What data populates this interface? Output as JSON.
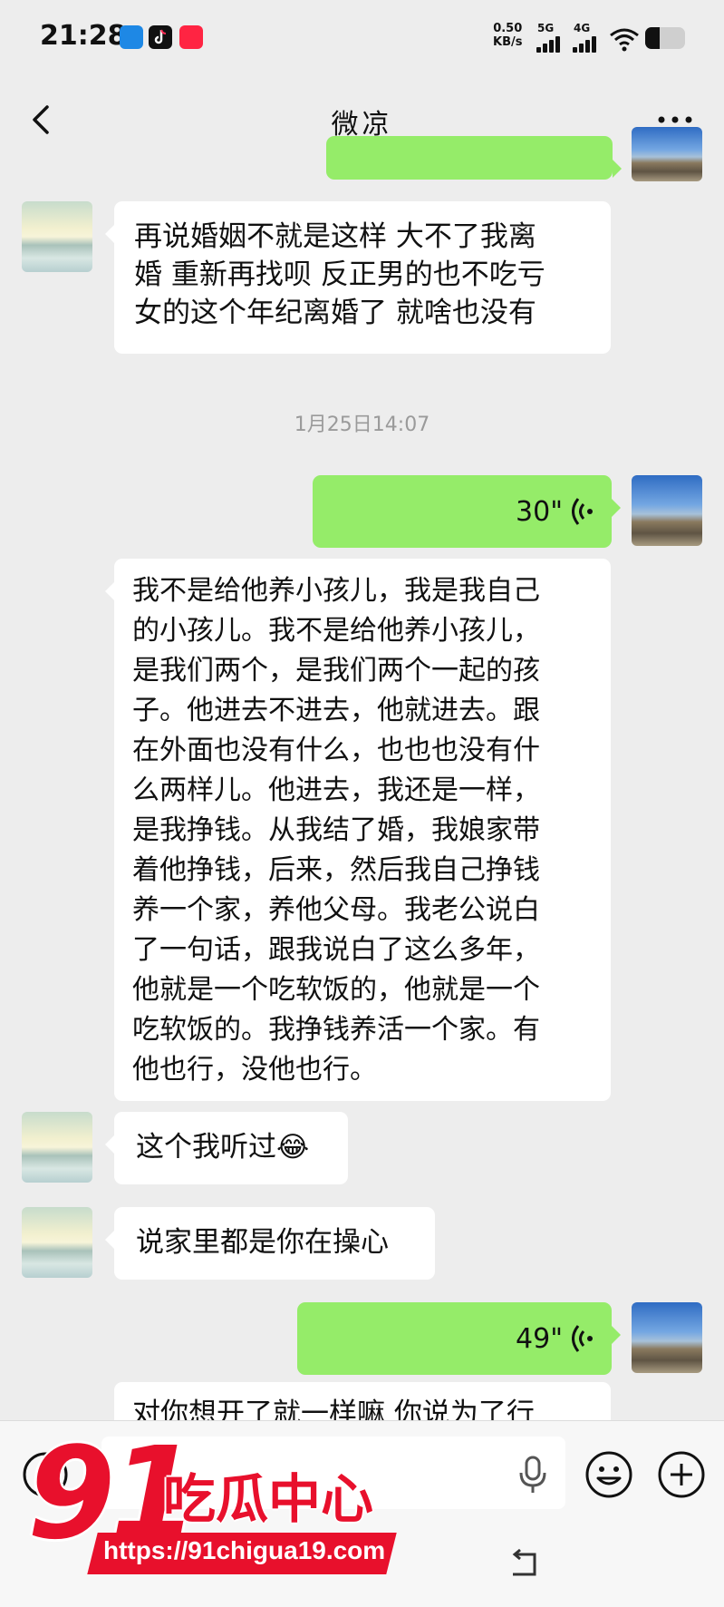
{
  "status_bar": {
    "time": "21:28",
    "net_speed_value": "0.50",
    "net_speed_unit": "KB/s",
    "sim1_label": "5G",
    "sim2_label": "4G"
  },
  "header": {
    "title": "微凉"
  },
  "messages": [
    {
      "from": "friend",
      "type": "text",
      "text": "再说婚姻不就是这样 大不了我离\n婚 重新再找呗 反正男的也不吃亏\n女的这个年纪离婚了 就啥也没有"
    },
    {
      "from": "system",
      "type": "time",
      "text": "1月25日14:07"
    },
    {
      "from": "me",
      "type": "voice",
      "duration": "30\""
    },
    {
      "from": "me",
      "type": "text",
      "text": "我不是给他养小孩儿，我是我自己\n的小孩儿。我不是给他养小孩儿，\n是我们两个，是我们两个一起的孩\n子。他进去不进去，他就进去。跟\n在外面也没有什么，也也也没有什\n么两样儿。他进去，我还是一样，\n是我挣钱。从我结了婚，我娘家带\n着他挣钱，后来，然后我自己挣钱\n养一个家，养他父母。我老公说白\n了一句话，跟我说白了这么多年，\n他就是一个吃软饭的，他就是一个\n吃软饭的。我挣钱养活一个家。有\n他也行，没他也行。"
    },
    {
      "from": "friend",
      "type": "text",
      "text": "这个我听过😂"
    },
    {
      "from": "friend",
      "type": "text",
      "text": "说家里都是你在操心"
    },
    {
      "from": "me",
      "type": "voice",
      "duration": "49\""
    },
    {
      "from": "me",
      "type": "text",
      "text": "对你想开了就一样嘛  你说为了行"
    }
  ],
  "watermark": {
    "number": "91",
    "name": "吃瓜中心",
    "url": "https://91chigua19.com"
  },
  "colors": {
    "background": "#ededed",
    "my_bubble": "#95ec69",
    "friend_bubble": "#ffffff",
    "watermark_red": "#e8102c"
  }
}
